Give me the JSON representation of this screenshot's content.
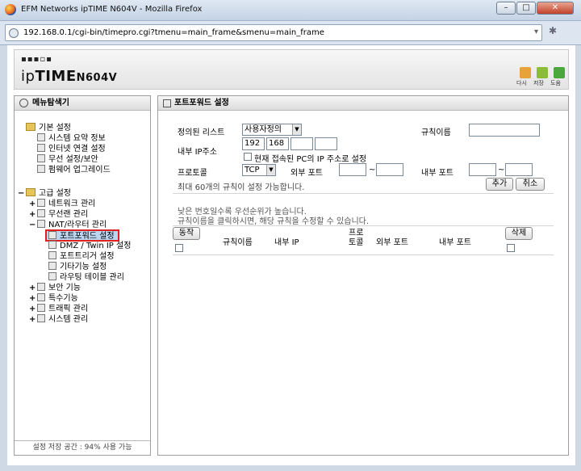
{
  "window": {
    "title": "EFM Networks ipTIME N604V - Mozilla Firefox",
    "minimize": "–",
    "maximize": "□",
    "close": "✕"
  },
  "browser": {
    "url": "192.168.0.1/cgi-bin/timepro.cgi?tmenu=main_frame&smenu=main_frame"
  },
  "header": {
    "logo_dots": "▪▪▪▫▪",
    "logo_ip": "ip",
    "logo_time": "TIME",
    "logo_model": "N604V",
    "icons": [
      {
        "label": "다시",
        "icon": "refresh-icon"
      },
      {
        "label": "저장",
        "icon": "save-icon"
      },
      {
        "label": "도움",
        "icon": "help-icon"
      }
    ]
  },
  "sidebar": {
    "title": "메뉴탐색기",
    "basic_group": "기본 설정",
    "basic_items": [
      "시스템 요약 정보",
      "인터넷 연결 설정",
      "무선 설정/보안",
      "펌웨어 업그레이드"
    ],
    "advanced_group": "고급 설정",
    "network_mgmt": "네트워크 관리",
    "wireless_mgmt": "무선랜 관리",
    "nat_router": "NAT/라우터 관리",
    "nat_items": [
      "포트포워드 설정",
      "DMZ / Twin IP 설정",
      "포트트리거 설정",
      "기타기능 설정",
      "라우팅 테이블 관리"
    ],
    "other_groups": [
      "보안 기능",
      "특수기능",
      "트래픽 관리",
      "시스템 관리"
    ],
    "footer": "설정 저장 공간 : 94% 사용 가능"
  },
  "content": {
    "title": "포트포워드 설정",
    "form": {
      "predefined_label": "정의된 리스트",
      "predefined_value": "사용자정의",
      "rule_name_label": "규칙이름",
      "rule_name_value": "",
      "internal_ip_label": "내부 IP주소",
      "ip_octets": [
        "192",
        "168",
        "",
        ""
      ],
      "current_pc_label": "현재 접속된 PC의 IP 주소로 설정",
      "protocol_label": "프로토콜",
      "protocol_value": "TCP",
      "external_port_label": "외부 포트",
      "internal_port_label": "내부 포트",
      "tilde": "~",
      "limit_note": "최대 60개의 규칙이 설정 가능합니다.",
      "add_button": "추가",
      "cancel_button": "취소"
    },
    "notes": [
      "낮은 번호일수록 우선순위가 높습니다.",
      "규칙이름을 클릭하시면, 해당 규칙을 수정할 수 있습니다."
    ],
    "table": {
      "run_button": "동작",
      "columns": [
        "규칙이름",
        "내부 IP",
        "프로\n토콜",
        "외부 포트",
        "내부 포트"
      ],
      "delete_button": "삭제"
    }
  }
}
